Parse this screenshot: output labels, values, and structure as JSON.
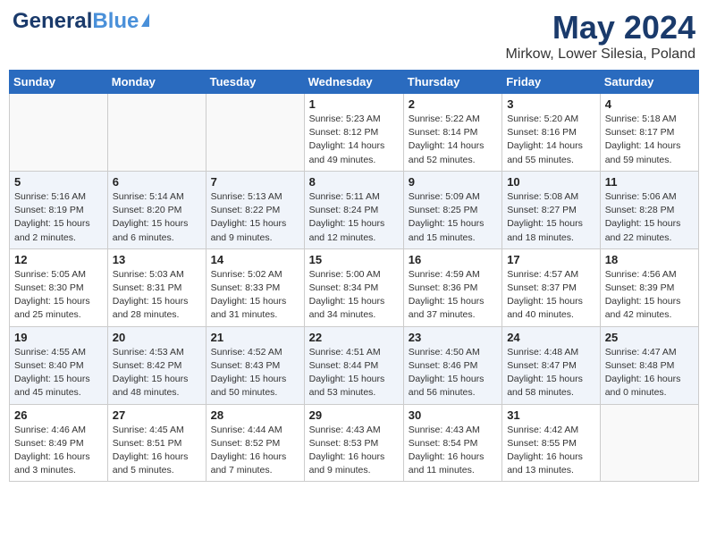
{
  "header": {
    "logo_general": "General",
    "logo_blue": "Blue",
    "title": "May 2024",
    "subtitle": "Mirkow, Lower Silesia, Poland"
  },
  "days_of_week": [
    "Sunday",
    "Monday",
    "Tuesday",
    "Wednesday",
    "Thursday",
    "Friday",
    "Saturday"
  ],
  "weeks": [
    [
      {
        "day": "",
        "info": ""
      },
      {
        "day": "",
        "info": ""
      },
      {
        "day": "",
        "info": ""
      },
      {
        "day": "1",
        "info": "Sunrise: 5:23 AM\nSunset: 8:12 PM\nDaylight: 14 hours\nand 49 minutes."
      },
      {
        "day": "2",
        "info": "Sunrise: 5:22 AM\nSunset: 8:14 PM\nDaylight: 14 hours\nand 52 minutes."
      },
      {
        "day": "3",
        "info": "Sunrise: 5:20 AM\nSunset: 8:16 PM\nDaylight: 14 hours\nand 55 minutes."
      },
      {
        "day": "4",
        "info": "Sunrise: 5:18 AM\nSunset: 8:17 PM\nDaylight: 14 hours\nand 59 minutes."
      }
    ],
    [
      {
        "day": "5",
        "info": "Sunrise: 5:16 AM\nSunset: 8:19 PM\nDaylight: 15 hours\nand 2 minutes."
      },
      {
        "day": "6",
        "info": "Sunrise: 5:14 AM\nSunset: 8:20 PM\nDaylight: 15 hours\nand 6 minutes."
      },
      {
        "day": "7",
        "info": "Sunrise: 5:13 AM\nSunset: 8:22 PM\nDaylight: 15 hours\nand 9 minutes."
      },
      {
        "day": "8",
        "info": "Sunrise: 5:11 AM\nSunset: 8:24 PM\nDaylight: 15 hours\nand 12 minutes."
      },
      {
        "day": "9",
        "info": "Sunrise: 5:09 AM\nSunset: 8:25 PM\nDaylight: 15 hours\nand 15 minutes."
      },
      {
        "day": "10",
        "info": "Sunrise: 5:08 AM\nSunset: 8:27 PM\nDaylight: 15 hours\nand 18 minutes."
      },
      {
        "day": "11",
        "info": "Sunrise: 5:06 AM\nSunset: 8:28 PM\nDaylight: 15 hours\nand 22 minutes."
      }
    ],
    [
      {
        "day": "12",
        "info": "Sunrise: 5:05 AM\nSunset: 8:30 PM\nDaylight: 15 hours\nand 25 minutes."
      },
      {
        "day": "13",
        "info": "Sunrise: 5:03 AM\nSunset: 8:31 PM\nDaylight: 15 hours\nand 28 minutes."
      },
      {
        "day": "14",
        "info": "Sunrise: 5:02 AM\nSunset: 8:33 PM\nDaylight: 15 hours\nand 31 minutes."
      },
      {
        "day": "15",
        "info": "Sunrise: 5:00 AM\nSunset: 8:34 PM\nDaylight: 15 hours\nand 34 minutes."
      },
      {
        "day": "16",
        "info": "Sunrise: 4:59 AM\nSunset: 8:36 PM\nDaylight: 15 hours\nand 37 minutes."
      },
      {
        "day": "17",
        "info": "Sunrise: 4:57 AM\nSunset: 8:37 PM\nDaylight: 15 hours\nand 40 minutes."
      },
      {
        "day": "18",
        "info": "Sunrise: 4:56 AM\nSunset: 8:39 PM\nDaylight: 15 hours\nand 42 minutes."
      }
    ],
    [
      {
        "day": "19",
        "info": "Sunrise: 4:55 AM\nSunset: 8:40 PM\nDaylight: 15 hours\nand 45 minutes."
      },
      {
        "day": "20",
        "info": "Sunrise: 4:53 AM\nSunset: 8:42 PM\nDaylight: 15 hours\nand 48 minutes."
      },
      {
        "day": "21",
        "info": "Sunrise: 4:52 AM\nSunset: 8:43 PM\nDaylight: 15 hours\nand 50 minutes."
      },
      {
        "day": "22",
        "info": "Sunrise: 4:51 AM\nSunset: 8:44 PM\nDaylight: 15 hours\nand 53 minutes."
      },
      {
        "day": "23",
        "info": "Sunrise: 4:50 AM\nSunset: 8:46 PM\nDaylight: 15 hours\nand 56 minutes."
      },
      {
        "day": "24",
        "info": "Sunrise: 4:48 AM\nSunset: 8:47 PM\nDaylight: 15 hours\nand 58 minutes."
      },
      {
        "day": "25",
        "info": "Sunrise: 4:47 AM\nSunset: 8:48 PM\nDaylight: 16 hours\nand 0 minutes."
      }
    ],
    [
      {
        "day": "26",
        "info": "Sunrise: 4:46 AM\nSunset: 8:49 PM\nDaylight: 16 hours\nand 3 minutes."
      },
      {
        "day": "27",
        "info": "Sunrise: 4:45 AM\nSunset: 8:51 PM\nDaylight: 16 hours\nand 5 minutes."
      },
      {
        "day": "28",
        "info": "Sunrise: 4:44 AM\nSunset: 8:52 PM\nDaylight: 16 hours\nand 7 minutes."
      },
      {
        "day": "29",
        "info": "Sunrise: 4:43 AM\nSunset: 8:53 PM\nDaylight: 16 hours\nand 9 minutes."
      },
      {
        "day": "30",
        "info": "Sunrise: 4:43 AM\nSunset: 8:54 PM\nDaylight: 16 hours\nand 11 minutes."
      },
      {
        "day": "31",
        "info": "Sunrise: 4:42 AM\nSunset: 8:55 PM\nDaylight: 16 hours\nand 13 minutes."
      },
      {
        "day": "",
        "info": ""
      }
    ]
  ]
}
